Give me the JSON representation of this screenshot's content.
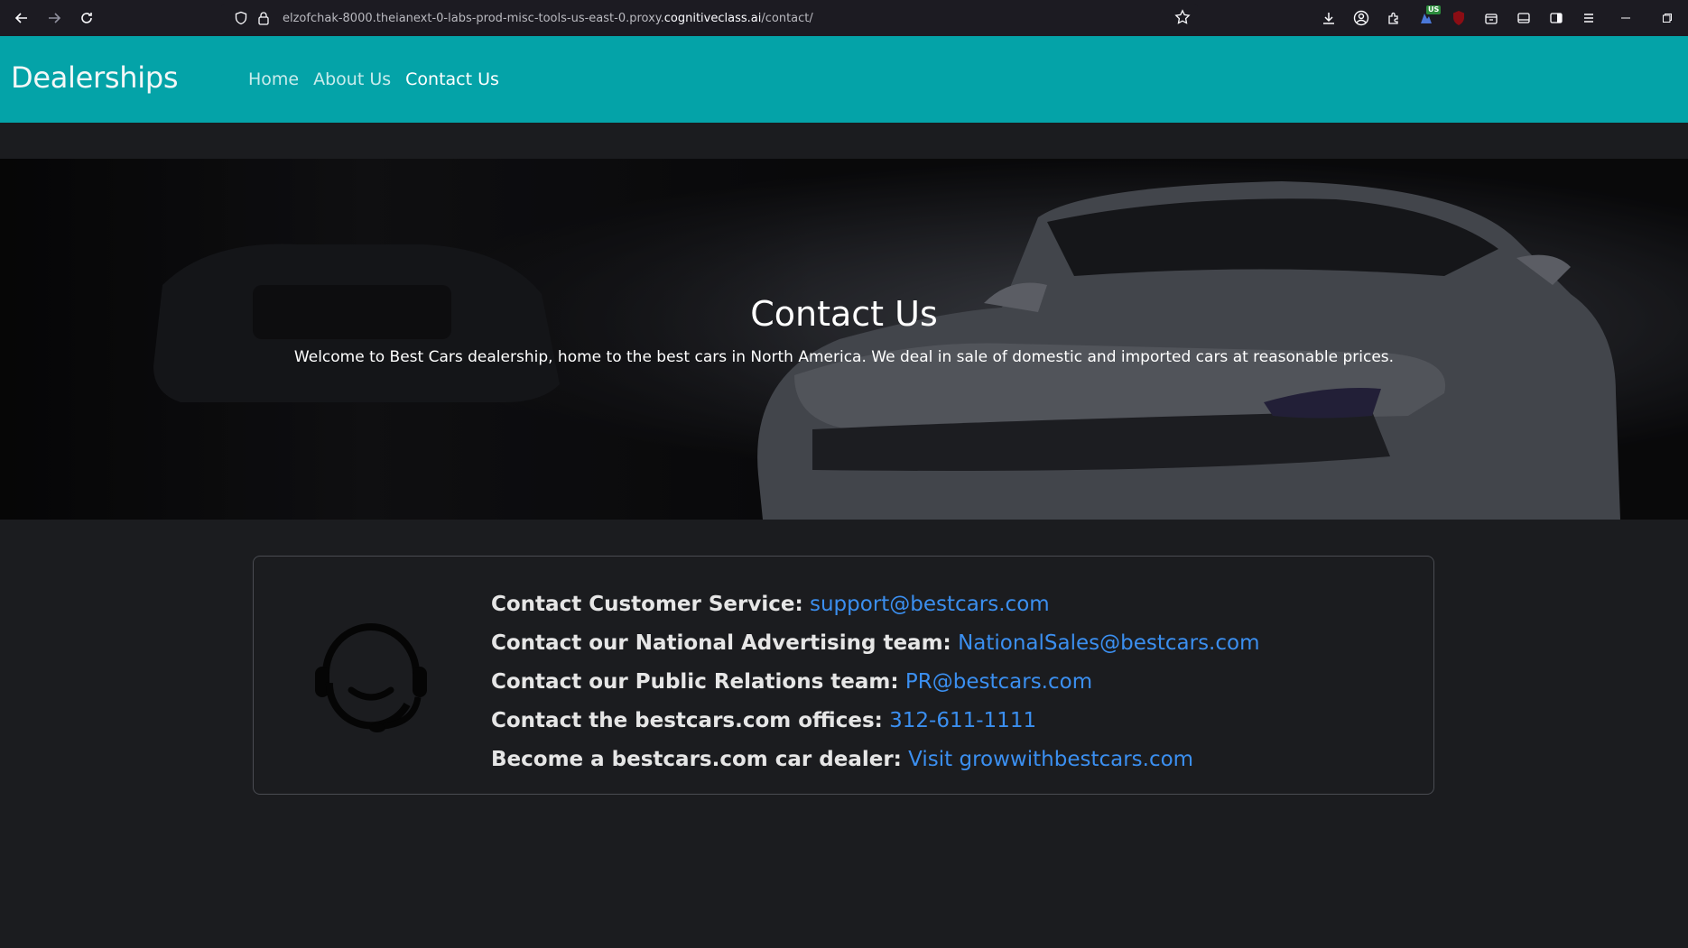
{
  "browser": {
    "url_prefix": "elzofchak-8000.theianext-0-labs-prod-misc-tools-us-east-0.proxy.",
    "url_host": "cognitiveclass.ai",
    "url_path": "/contact/",
    "ext_badge": "US"
  },
  "navbar": {
    "brand": "Dealerships",
    "links": [
      {
        "label": "Home",
        "active": false
      },
      {
        "label": "About Us",
        "active": false
      },
      {
        "label": "Contact Us",
        "active": true
      }
    ],
    "color": "#04a3a8"
  },
  "hero": {
    "title": "Contact Us",
    "text": "Welcome to Best Cars dealership, home to the best cars in North America. We deal in sale of domestic and imported cars at reasonable prices."
  },
  "contacts": [
    {
      "label": "Contact Customer Service:",
      "link": "support@bestcars.com"
    },
    {
      "label": "Contact our National Advertising team:",
      "link": "NationalSales@bestcars.com"
    },
    {
      "label": "Contact our Public Relations team:",
      "link": "PR@bestcars.com"
    },
    {
      "label": "Contact the bestcars.com offices:",
      "link": "312-611-1111"
    },
    {
      "label": "Become a bestcars.com car dealer:",
      "link": "Visit growwithbestcars.com"
    }
  ],
  "colors": {
    "link": "#3b8ff0",
    "background": "#1b1c1f"
  },
  "icons": {
    "card_icon": "headset-icon"
  }
}
